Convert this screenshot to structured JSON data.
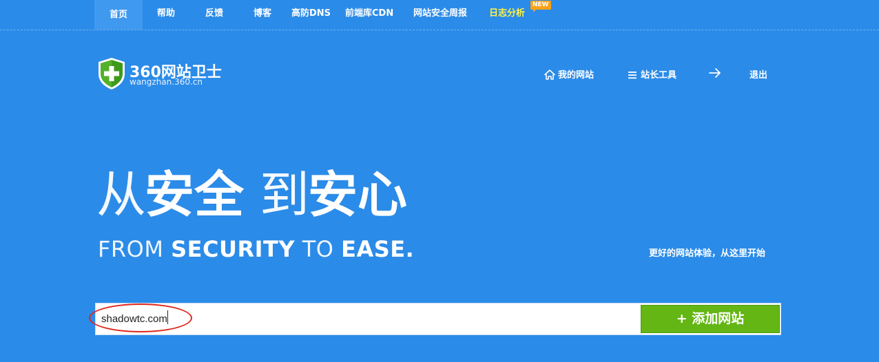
{
  "topnav": {
    "items": [
      {
        "label": "首页",
        "active": true
      },
      {
        "label": "帮助"
      },
      {
        "label": "反馈"
      },
      {
        "label": "博客"
      },
      {
        "label": "高防DNS"
      },
      {
        "label": "前端库CDN"
      },
      {
        "label": "网站安全周报"
      },
      {
        "label": "日志分析",
        "highlight": true
      }
    ],
    "new_badge": "NEW"
  },
  "logo": {
    "title": "360网站卫士",
    "subtitle": "wangzhan.360.cn"
  },
  "header_nav": {
    "my_sites": "我的网站",
    "webmaster_tools": "站长工具",
    "logout": "退出"
  },
  "hero": {
    "cn_from": "从",
    "cn_security": "安全",
    "cn_to": "到",
    "cn_ease": "安心",
    "en_from": "FROM",
    "en_security": "SECURITY",
    "en_to": "TO",
    "en_ease": "EASE.",
    "tagline": "更好的网站体验，从这里开始"
  },
  "add_site": {
    "input_value": "shadowtc.com",
    "button_label": "+ 添加网站"
  },
  "colors": {
    "background": "#2b8be8",
    "active_tab": "#3f99ee",
    "highlight_text": "#fff34a",
    "badge": "#f7a21b",
    "add_button": "#63b614",
    "annotation_ellipse": "#e0271b"
  },
  "icons": [
    "shield-logo-icon",
    "home-icon",
    "menu-icon",
    "arrow-right-icon"
  ]
}
